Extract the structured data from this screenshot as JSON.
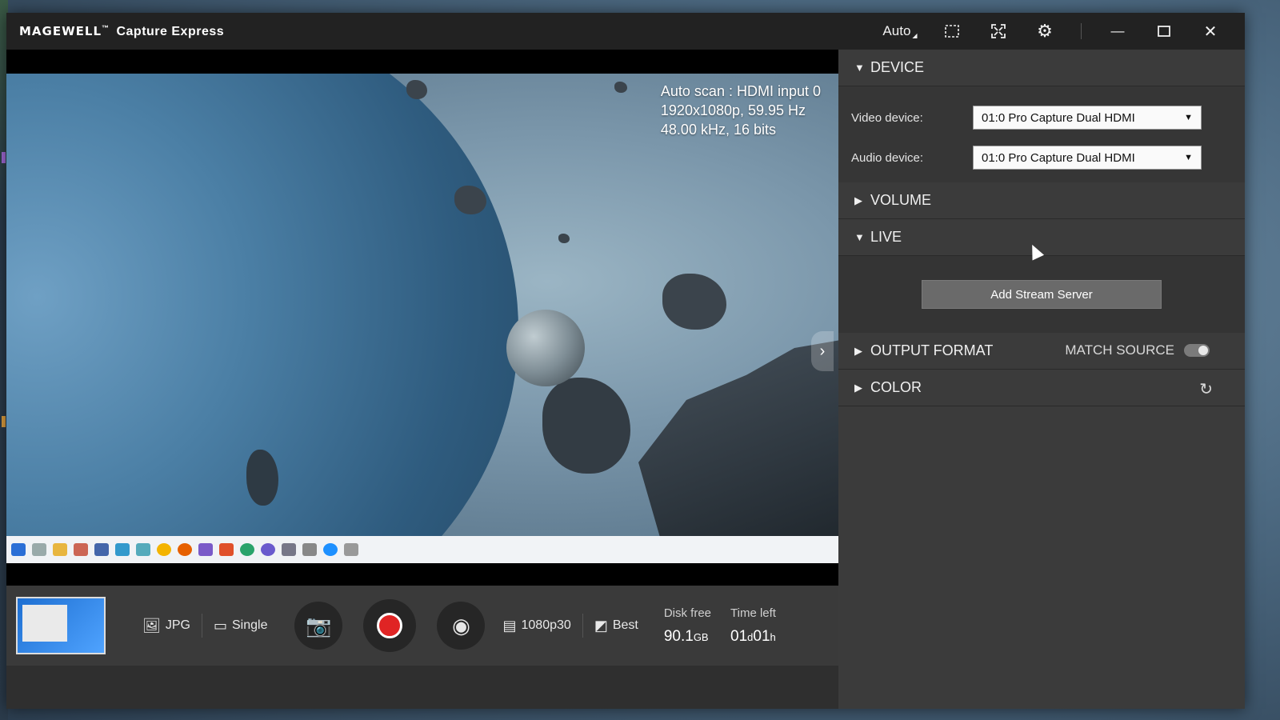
{
  "window": {
    "brand_logo": "MAGEWELL",
    "brand_tm": "™",
    "app_name": "Capture Express"
  },
  "titlebar": {
    "auto_label": "Auto",
    "icons": [
      "fit-window-icon",
      "fullscreen-icon",
      "gear-icon",
      "minimize-icon",
      "maximize-icon",
      "close-icon"
    ]
  },
  "preview": {
    "scan_line1": "Auto scan : HDMI input 0",
    "scan_line2": "1920x1080p, 59.95 Hz",
    "scan_line3": "48.00 kHz, 16 bits"
  },
  "controls": {
    "image_format": "JPG",
    "capture_mode": "Single",
    "resolution": "1080p30",
    "quality": "Best",
    "disk_free_label": "Disk free",
    "disk_free_value": "90.1",
    "disk_free_unit": "GB",
    "time_left_label": "Time left",
    "time_left_days": "01",
    "time_left_days_unit": "d",
    "time_left_hours": "01",
    "time_left_hours_unit": "h"
  },
  "panel": {
    "device": {
      "title": "DEVICE",
      "video_label": "Video device:",
      "video_value": "01:0 Pro Capture Dual HDMI",
      "audio_label": "Audio device:",
      "audio_value": "01:0 Pro Capture Dual HDMI"
    },
    "volume": {
      "title": "VOLUME"
    },
    "live": {
      "title": "LIVE",
      "add_button": "Add Stream Server"
    },
    "output_format": {
      "title": "OUTPUT FORMAT",
      "match_source": "MATCH SOURCE"
    },
    "color": {
      "title": "COLOR"
    }
  },
  "colors": {
    "record": "#e02424",
    "panel_bg": "#3b3b3b",
    "titlebar_bg": "#222222"
  }
}
